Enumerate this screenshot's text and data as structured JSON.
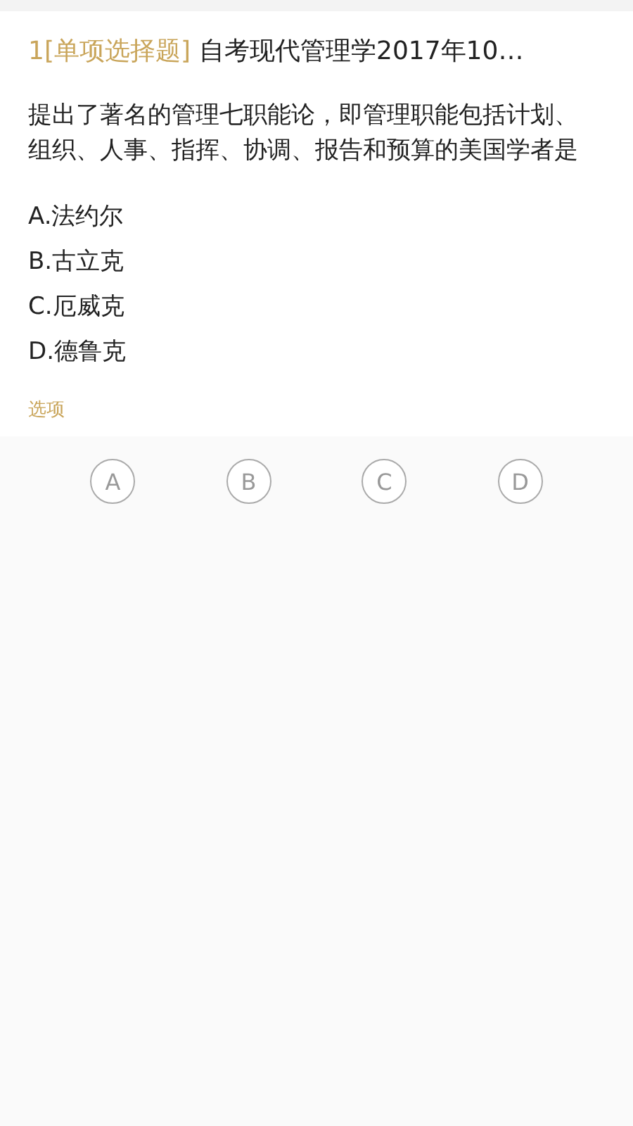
{
  "question": {
    "number": "1",
    "type_label": "[单项选择题]",
    "source": "自考现代管理学2017年10…",
    "text": "提出了著名的管理七职能论，即管理职能包括计划、组织、人事、指挥、协调、报告和预算的美国学者是"
  },
  "options": [
    "A.法约尔",
    "B.古立克",
    "C.厄威克",
    "D.德鲁克"
  ],
  "answer_label": "选项",
  "answer_buttons": [
    {
      "label": "A",
      "selected": false
    },
    {
      "label": "B",
      "selected": false
    },
    {
      "label": "C",
      "selected": false
    },
    {
      "label": "D",
      "selected": false
    }
  ]
}
